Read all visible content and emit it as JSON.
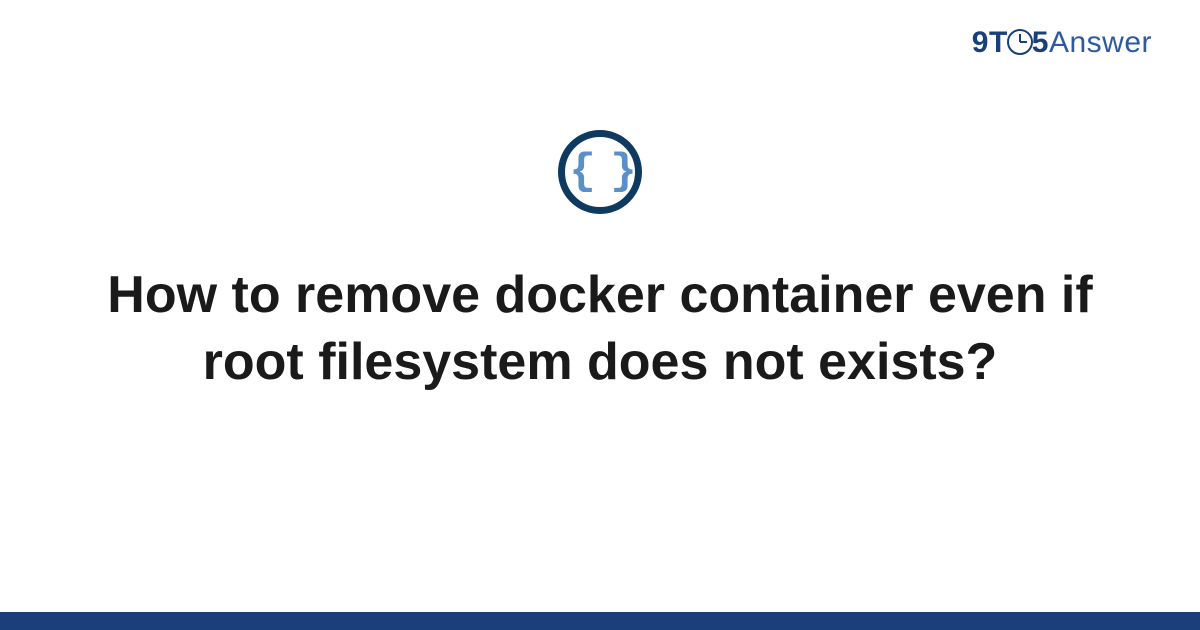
{
  "brand": {
    "nine": "9",
    "t": "T",
    "five": "5",
    "answer": "Answer"
  },
  "icon": {
    "braces": "{ }",
    "name": "code-braces-icon"
  },
  "title": "How to remove docker container even if root filesystem does not exists?",
  "colors": {
    "brand_color": "#1a3f7a",
    "icon_ring": "#0f3a5f",
    "braces_color": "#5a8fc7"
  }
}
